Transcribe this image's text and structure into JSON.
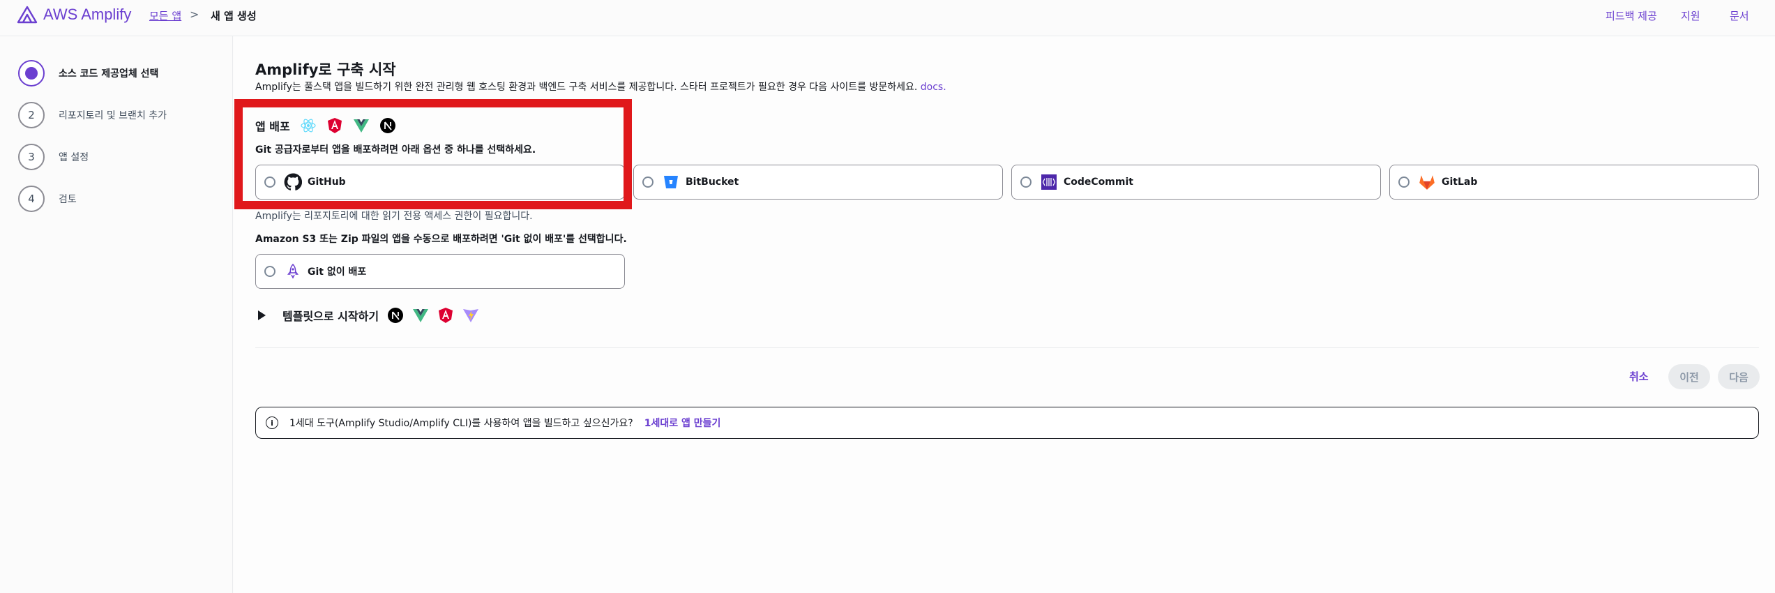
{
  "header": {
    "logo_text": "AWS Amplify",
    "breadcrumb": {
      "link": "모든 앱",
      "separator": ">",
      "current": "새 앱 생성"
    },
    "links": [
      "피드백 제공",
      "지원",
      "문서"
    ]
  },
  "steps": [
    {
      "number": "",
      "label": "소스 코드 제공업체 선택",
      "active": true
    },
    {
      "number": "2",
      "label": "리포지토리 및 브랜치 추가",
      "active": false
    },
    {
      "number": "3",
      "label": "앱 설정",
      "active": false
    },
    {
      "number": "4",
      "label": "검토",
      "active": false
    }
  ],
  "main": {
    "title": "Amplify로 구축 시작",
    "description": "Amplify는 풀스택 앱을 빌드하기 위한 완전 관리형 웹 호스팅 환경과 백엔드 구축 서비스를 제공합니다. 스타터 프로젝트가 필요한 경우 다음 사이트를 방문하세요.",
    "docs_link": "docs.",
    "deploy_title": "앱 배포",
    "deploy_subtitle": "Git 공급자로부터 앱을 배포하려면 아래 옵션 중 하나를 선택하세요.",
    "providers": [
      {
        "label": "GitHub",
        "icon": "github-icon"
      },
      {
        "label": "BitBucket",
        "icon": "bitbucket-icon"
      },
      {
        "label": "CodeCommit",
        "icon": "codecommit-icon"
      },
      {
        "label": "GitLab",
        "icon": "gitlab-icon"
      }
    ],
    "repo_note": "Amplify는 리포지토리에 대한 읽기 전용 액세스 권한이 필요합니다.",
    "manual_note": "Amazon S3 또는 Zip 파일의 앱을 수동으로 배포하려면 'Git 없이 배포'를 선택합니다.",
    "manual_option": "Git 없이 배포",
    "template_label": "템플릿으로 시작하기",
    "buttons": {
      "cancel": "취소",
      "previous": "이전",
      "next": "다음"
    },
    "info": {
      "icon": "i",
      "text": "1세대 도구(Amplify Studio/Amplify CLI)를 사용하여 앱을 빌드하고 싶으신가요?",
      "link": "1세대로 앱 만들기"
    }
  },
  "colors": {
    "accent": "#6b3fd0",
    "highlight": "#e0181b"
  }
}
